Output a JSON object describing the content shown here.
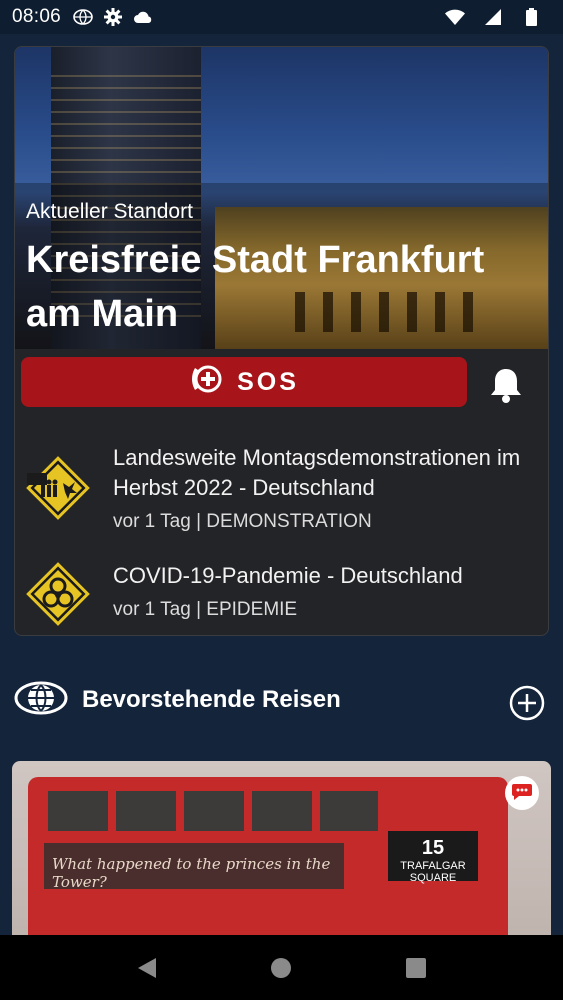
{
  "status_bar": {
    "time": "08:06",
    "icons": [
      "globe-icon",
      "gear-icon",
      "cloud-icon",
      "wifi-icon",
      "signal-icon",
      "battery-icon"
    ]
  },
  "location": {
    "label": "Aktueller Standort",
    "name": "Kreisfreie Stadt Frankfurt am Main"
  },
  "sos": {
    "label": "SOS",
    "color": "#a7151a"
  },
  "alerts": [
    {
      "title": "Landesweite Montagsdemonstrationen im Herbst 2022 - Deutschland",
      "meta": "vor 1 Tag | DEMONSTRATION",
      "icon": "demonstration-warning-icon"
    },
    {
      "title": "COVID-19-Pandemie - Deutschland",
      "meta": "vor 1 Tag | EPIDEMIE",
      "icon": "biohazard-warning-icon"
    }
  ],
  "upcoming": {
    "title": "Bevorstehende Reisen",
    "add_icon": "add-circle-icon"
  },
  "trip": {
    "ad_text": "What happened to the princes in the Tower?",
    "bus_number": "15",
    "bus_destination": "TRAFALGAR SQUARE"
  },
  "nav_bar": {
    "buttons": [
      "back-icon",
      "home-icon",
      "recents-icon"
    ]
  }
}
